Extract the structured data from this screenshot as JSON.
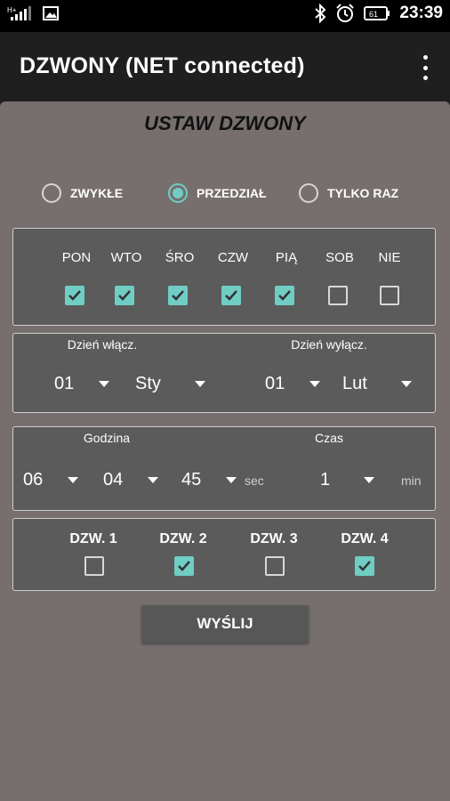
{
  "status_bar": {
    "time": "23:39",
    "battery": "61"
  },
  "app_bar": {
    "title": "DZWONY (NET connected)"
  },
  "heading": "USTAW DZWONY",
  "mode_options": [
    {
      "label": "ZWYKŁE",
      "selected": false
    },
    {
      "label": "PRZEDZIAŁ",
      "selected": true
    },
    {
      "label": "TYLKO RAZ",
      "selected": false
    }
  ],
  "days": [
    {
      "label": "PON",
      "checked": true
    },
    {
      "label": "WTO",
      "checked": true
    },
    {
      "label": "ŚRO",
      "checked": true
    },
    {
      "label": "CZW",
      "checked": true
    },
    {
      "label": "PIĄ",
      "checked": true
    },
    {
      "label": "SOB",
      "checked": false
    },
    {
      "label": "NIE",
      "checked": false
    }
  ],
  "date_range": {
    "on_label": "Dzień włącz.",
    "off_label": "Dzień wyłącz.",
    "on_day": "01",
    "on_month": "Sty",
    "off_day": "01",
    "off_month": "Lut"
  },
  "time": {
    "hour_label": "Godzina",
    "duration_label": "Czas",
    "hour": "06",
    "minute": "04",
    "second": "45",
    "sec_unit": "sec",
    "duration": "1",
    "min_unit": "min"
  },
  "bells": [
    {
      "label": "DZW. 1",
      "checked": false
    },
    {
      "label": "DZW. 2",
      "checked": true
    },
    {
      "label": "DZW. 3",
      "checked": false
    },
    {
      "label": "DZW. 4",
      "checked": true
    }
  ],
  "send_button": "WYŚLIJ",
  "colors": {
    "accent": "#6fcdc4",
    "panel": "#766f6e",
    "box": "#5b5b5b"
  }
}
